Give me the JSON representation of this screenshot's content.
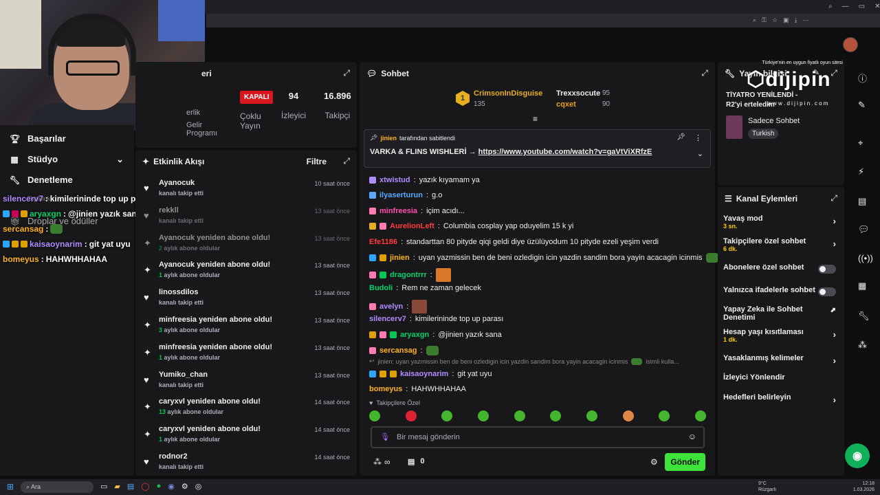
{
  "browser": {
    "window_controls": [
      "⌕",
      "—",
      "▭",
      "✕"
    ]
  },
  "left_nav": {
    "items": [
      {
        "icon": "trophy-icon",
        "label": "Başarılar"
      },
      {
        "icon": "studio-icon",
        "label": "Stüdyo"
      },
      {
        "icon": "wrench-icon",
        "label": "Denetleme"
      },
      {
        "icon": "gift-icon",
        "label": "Droplar ve ödüller"
      }
    ],
    "partial_label": "Topluluk"
  },
  "overlay_chat": [
    {
      "user": "silencerv7",
      "text": "kimilerininde top up parası",
      "color": "#b08cff"
    },
    {
      "user": "aryaxgn",
      "text": "@jinien yazık sana",
      "color": "#00d26a"
    },
    {
      "user": "sercansag",
      "text": "",
      "color": "#ffb31a"
    },
    {
      "user": "kaisaoynarim",
      "text": "git yat uyu",
      "color": "#b08cff"
    },
    {
      "user": "bomeyus",
      "text": "HAHWHHAHAA",
      "color": "#ffb31a"
    }
  ],
  "stats": {
    "title_partial": "eri",
    "status_label": "KAPALI",
    "status_sub": "Çoklu Yayın",
    "viewers": "94",
    "viewers_label": "İzleyici",
    "followers": "16.896",
    "followers_label": "Takipçi",
    "partner_partial": [
      "erlik",
      "Gelir",
      "Programı"
    ]
  },
  "activity": {
    "title": "Etkinlik Akışı",
    "filter": "Filtre",
    "items": [
      {
        "name": "Ayanocuk",
        "desc": "kanalı takip etti",
        "months": "",
        "time": "10 saat önce",
        "icon": "heart",
        "dim": false
      },
      {
        "name": "rekkll",
        "desc": "kanalı takip etti",
        "months": "",
        "time": "13 saat önce",
        "icon": "heart",
        "dim": true
      },
      {
        "name": "Ayanocuk yeniden abone oldu!",
        "desc": "aylık abone oldular",
        "months": "2",
        "time": "13 saat önce",
        "icon": "star",
        "dim": true
      },
      {
        "name": "Ayanocuk yeniden abone oldu!",
        "desc": "aylık abone oldular",
        "months": "1",
        "time": "13 saat önce",
        "icon": "star",
        "dim": false
      },
      {
        "name": "linossdilos",
        "desc": "kanalı takip etti",
        "months": "",
        "time": "13 saat önce",
        "icon": "heart",
        "dim": false
      },
      {
        "name": "minfreesia yeniden abone oldu!",
        "desc": "aylık abone oldular",
        "months": "3",
        "time": "13 saat önce",
        "icon": "star",
        "dim": false
      },
      {
        "name": "minfreesia yeniden abone oldu!",
        "desc": "aylık abone oldular",
        "months": "1",
        "time": "13 saat önce",
        "icon": "star",
        "dim": false
      },
      {
        "name": "Yumiko_chan",
        "desc": "kanalı takip etti",
        "months": "",
        "time": "13 saat önce",
        "icon": "heart",
        "dim": false
      },
      {
        "name": "caryxvl yeniden abone oldu!",
        "desc": "aylık abone oldular",
        "months": "13",
        "time": "14 saat önce",
        "icon": "star",
        "dim": false
      },
      {
        "name": "caryxvl yeniden abone oldu!",
        "desc": "aylık abone oldular",
        "months": "1",
        "time": "14 saat önce",
        "icon": "star",
        "dim": false
      },
      {
        "name": "rodnor2",
        "desc": "kanalı takip etti",
        "months": "",
        "time": "14 saat önce",
        "icon": "heart",
        "dim": false
      }
    ]
  },
  "chat": {
    "title": "Sohbet",
    "leaderboard": {
      "first_name": "CrimsonInDisguise",
      "first_score": "135",
      "first_rank": "1",
      "second_name": "Trexxsocute",
      "second_score": "95",
      "third_name": "cqxet",
      "third_score": "90"
    },
    "pinned": {
      "by": "jinien",
      "by_suffix": "tarafından sabitlendi",
      "text": "VARKA & FLINS WISHLERİ →",
      "link": "https://www.youtube.com/watch?v=gaVtViXRfzE"
    },
    "messages": [
      {
        "user": "xtwistud",
        "text": "yazık kıyamam ya",
        "color": "#b08cff"
      },
      {
        "user": "ilyaserturun",
        "text": "g.o",
        "color": "#5aa8ff"
      },
      {
        "user": "minfreesia",
        "text": "içim acıdı...",
        "color": "#ff4fb0"
      },
      {
        "user": "AurelionLeft",
        "text": "Columbia cosplay yap oduyelim 15 k yi",
        "color": "#ff3b3b"
      },
      {
        "user": "Efe1186",
        "text": "standarttan 80 pityde qiqi geldi diye üzülüyodum 10 pityde ezeli yeşim verdi",
        "color": "#ff3b3b"
      },
      {
        "user": "jinien",
        "text": "uyan yazmissin ben de beni ozledigin icin yazdin sandim bora yayin acacagin icinmis",
        "color": "#ffb31a"
      },
      {
        "user": "dragontrrr",
        "text": "",
        "color": "#00d26a"
      },
      {
        "user": "Budoli",
        "text": "Rem ne zaman gelecek",
        "color": "#00d26a"
      },
      {
        "user": "avelyn",
        "text": "",
        "color": "#b08cff"
      },
      {
        "user": "silencerv7",
        "text": "kimilerininde top up parası",
        "color": "#b08cff"
      },
      {
        "user": "aryaxgn",
        "text": "@jinien yazık sana",
        "color": "#00d26a"
      },
      {
        "user": "sercansag",
        "text": "",
        "color": "#ffb31a"
      },
      {
        "user": "kaisaoynarim",
        "text": "git yat uyu",
        "color": "#b08cff"
      },
      {
        "user": "bomeyus",
        "text": "HAHWHHAHAA",
        "color": "#ffb31a"
      }
    ],
    "reply_preview": "jinien: uyan yazmissin ben de beni ozledigin icin yazdin sandim bora yayin acacagin icinmis",
    "reply_suffix": "isimli kulla...",
    "followers_only": "Takipçilere Özel",
    "placeholder": "Bir mesaj gönderin",
    "points": "∞",
    "bits": "0",
    "send": "Gönder"
  },
  "stream_info": {
    "title": "Yayın bilgisi",
    "stream_title": "TİYATRO YENİLENDİ - R2'yi erteledim",
    "category": "Sadece Sohbet",
    "tag": "Turkish"
  },
  "ad": {
    "tagline": "Türkiye'nin en uygun fiyatlı oyun sitesi",
    "brand": "dijipin",
    "url": "w w w . d i j i p i n . c o m"
  },
  "channel_actions": {
    "title": "Kanal Eylemleri",
    "items": [
      {
        "label": "Yavaş mod",
        "sub": "3 sn.",
        "kind": "chevron"
      },
      {
        "label": "Takipçilere özel sohbet",
        "sub": "6 dk.",
        "kind": "chevron"
      },
      {
        "label": "Abonelere özel sohbet",
        "sub": "",
        "kind": "toggle"
      },
      {
        "label": "Yalnızca ifadelerle sohbet",
        "sub": "",
        "kind": "toggle"
      },
      {
        "label": "Yapay Zeka ile Sohbet Denetimi",
        "sub": "",
        "kind": "external"
      },
      {
        "label": "Hesap yaşı kısıtlaması",
        "sub": "1 dk.",
        "kind": "chevron"
      },
      {
        "label": "Yasaklanmış kelimeler",
        "sub": "",
        "kind": "chevron"
      },
      {
        "label": "İzleyici Yönlendir",
        "sub": "",
        "kind": "none"
      },
      {
        "label": "Hedefleri belirleyin",
        "sub": "",
        "kind": "chevron"
      }
    ]
  },
  "taskbar": {
    "search": "Ara",
    "weather_temp": "9°C",
    "weather_desc": "Rüzgarlı",
    "time": "12:18",
    "date": "1.03.2026"
  }
}
